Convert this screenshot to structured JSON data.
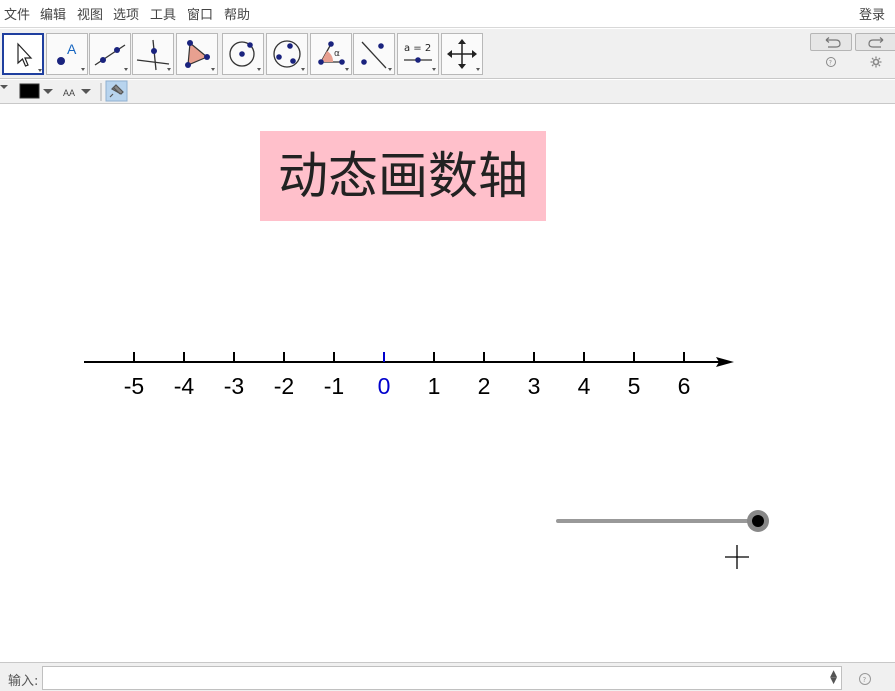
{
  "menu": {
    "items": [
      "文件",
      "编辑",
      "视图",
      "选项",
      "工具",
      "窗口",
      "帮助"
    ],
    "login": "登录"
  },
  "toolbar": {
    "tools": [
      {
        "name": "move-tool-icon",
        "active": true
      },
      {
        "name": "point-tool-icon",
        "label": "A"
      },
      {
        "name": "line-tool-icon"
      },
      {
        "name": "perpendicular-line-tool-icon"
      },
      {
        "name": "polygon-tool-icon"
      },
      {
        "name": "circle-center-point-tool-icon"
      },
      {
        "name": "circle-three-points-tool-icon"
      },
      {
        "name": "angle-tool-icon",
        "label": "α"
      },
      {
        "name": "reflect-tool-icon"
      },
      {
        "name": "slider-tool-icon",
        "label": "a = 2"
      },
      {
        "name": "move-graphics-view-tool-icon"
      }
    ]
  },
  "stylebar": {
    "color": "#000000",
    "text_size_label": "AA"
  },
  "graphics": {
    "title": "动态画数轴",
    "title_bg": "#ffc0cb",
    "number_line": {
      "ticks": [
        "-5",
        "-4",
        "-3",
        "-2",
        "-1",
        "0",
        "1",
        "2",
        "3",
        "4",
        "5",
        "6"
      ],
      "origin_label": "0",
      "origin_color": "#0000cc"
    },
    "slider": {
      "value": 1.0
    }
  },
  "inputbar": {
    "label": "输入:",
    "placeholder": ""
  }
}
